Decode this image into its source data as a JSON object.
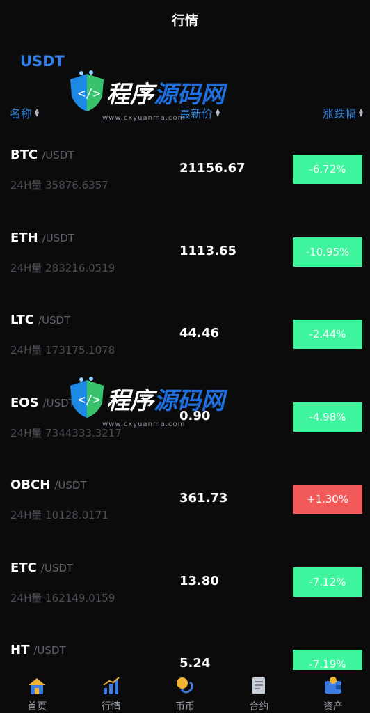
{
  "header": {
    "title": "行情"
  },
  "tabs": {
    "active": "USDT"
  },
  "columns": {
    "name": "名称",
    "price": "最新价",
    "change": "涨跌幅"
  },
  "rows": [
    {
      "code": "BTC",
      "quote": "/USDT",
      "volume": "24H量 35876.6357",
      "price": "21156.67",
      "change": "-6.72%",
      "trend": "down"
    },
    {
      "code": "ETH",
      "quote": "/USDT",
      "volume": "24H量 283216.0519",
      "price": "1113.65",
      "change": "-10.95%",
      "trend": "down"
    },
    {
      "code": "LTC",
      "quote": "/USDT",
      "volume": "24H量 173175.1078",
      "price": "44.46",
      "change": "-2.44%",
      "trend": "down"
    },
    {
      "code": "EOS",
      "quote": "/USDT",
      "volume": "24H量 7344333.3217",
      "price": "0.90",
      "change": "-4.98%",
      "trend": "down"
    },
    {
      "code": "OBCH",
      "quote": "/USDT",
      "volume": "24H量 10128.0171",
      "price": "361.73",
      "change": "+1.30%",
      "trend": "up"
    },
    {
      "code": "ETC",
      "quote": "/USDT",
      "volume": "24H量 162149.0159",
      "price": "13.80",
      "change": "-7.12%",
      "trend": "down"
    },
    {
      "code": "HT",
      "quote": "/USDT",
      "volume": "",
      "price": "5.24",
      "change": "-7.19%",
      "trend": "down"
    }
  ],
  "colors": {
    "down": "#3ef59d",
    "up": "#f25a5a",
    "accent": "#2f80ed"
  },
  "tabbar": [
    {
      "label": "首页",
      "icon": "home-icon"
    },
    {
      "label": "行情",
      "icon": "chart-icon"
    },
    {
      "label": "币币",
      "icon": "exchange-icon"
    },
    {
      "label": "合约",
      "icon": "contract-icon"
    },
    {
      "label": "资产",
      "icon": "wallet-icon"
    }
  ],
  "watermark": {
    "text": "程序源码网",
    "url": "www.cxyuanma.com"
  }
}
